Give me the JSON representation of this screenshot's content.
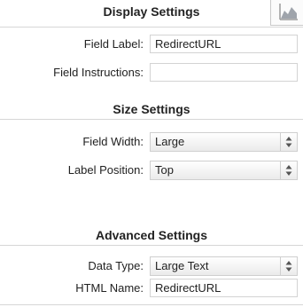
{
  "display_settings": {
    "title": "Display Settings",
    "field_label": {
      "label": "Field Label:",
      "value": "RedirectURL"
    },
    "field_instructions": {
      "label": "Field Instructions:",
      "value": ""
    }
  },
  "size_settings": {
    "title": "Size Settings",
    "field_width": {
      "label": "Field Width:",
      "value": "Large"
    },
    "label_position": {
      "label": "Label Position:",
      "value": "Top"
    }
  },
  "advanced_settings": {
    "title": "Advanced Settings",
    "data_type": {
      "label": "Data Type:",
      "value": "Large Text"
    },
    "html_name": {
      "label": "HTML Name:",
      "value": "RedirectURL"
    }
  },
  "icons": {
    "corner": "chart-icon",
    "stepper": "up-down-arrows-icon"
  }
}
